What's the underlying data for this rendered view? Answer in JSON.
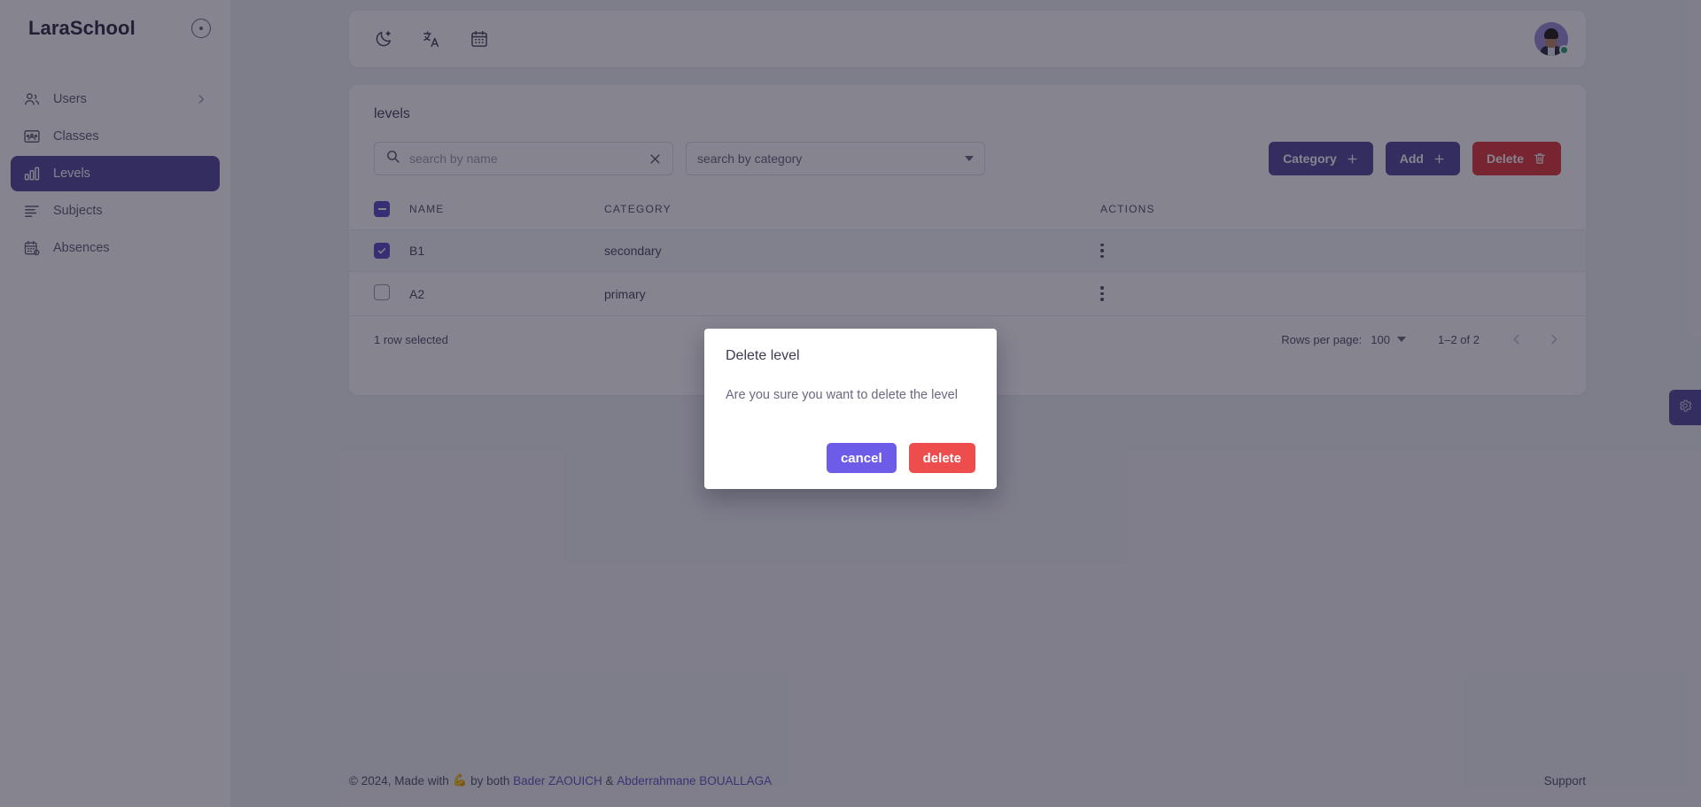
{
  "app": {
    "brand": "LaraSchool"
  },
  "sidebar": {
    "items": [
      {
        "label": "Users",
        "icon": "users-icon",
        "active": false,
        "has_chevron": true
      },
      {
        "label": "Classes",
        "icon": "classes-icon",
        "active": false,
        "has_chevron": false
      },
      {
        "label": "Levels",
        "icon": "levels-icon",
        "active": true,
        "has_chevron": false
      },
      {
        "label": "Subjects",
        "icon": "subjects-icon",
        "active": false,
        "has_chevron": false
      },
      {
        "label": "Absences",
        "icon": "absences-icon",
        "active": false,
        "has_chevron": false
      }
    ]
  },
  "topbar": {
    "tools": [
      {
        "name": "dark-mode-icon"
      },
      {
        "name": "translate-icon"
      },
      {
        "name": "calendar-icon"
      }
    ],
    "avatar_status": "online"
  },
  "card": {
    "title": "levels",
    "search": {
      "value": "",
      "placeholder": "search by name"
    },
    "category_select": {
      "value": "search by category"
    },
    "buttons": [
      {
        "label": "Category",
        "icon": "plus-icon",
        "style": "purple"
      },
      {
        "label": "Add",
        "icon": "plus-icon",
        "style": "purple"
      },
      {
        "label": "Delete",
        "icon": "trash-icon",
        "style": "red"
      }
    ],
    "table": {
      "headers": [
        "NAME",
        "CATEGORY",
        "ACTIONS"
      ],
      "header_checkbox": "indeterminate",
      "rows": [
        {
          "checked": true,
          "name": "B1",
          "category": "secondary"
        },
        {
          "checked": false,
          "name": "A2",
          "category": "primary"
        }
      ]
    },
    "footer": {
      "selection": "1 row selected",
      "rows_per_page_label": "Rows per page:",
      "rows_per_page_value": "100",
      "range": "1–2 of 2"
    }
  },
  "page_footer": {
    "copyright": "© 2024, Made with",
    "emoji": "💪",
    "by": "by both",
    "author1": "Bader ZAOUICH",
    "amp": "&",
    "author2": "Abderrahmane BOUALLAGA",
    "support": "Support"
  },
  "modal": {
    "title": "Delete level",
    "body": "Are you sure you want to delete the level",
    "cancel_label": "cancel",
    "delete_label": "delete"
  },
  "colors": {
    "accent_purple": "#554d9b",
    "modal_cancel": "#6c5ce7",
    "danger_red": "#e23b3b",
    "modal_delete": "#ee4d4d",
    "checkbox_on": "#5b4fc4",
    "link": "#6257c4",
    "status_online": "#2ea16e"
  }
}
